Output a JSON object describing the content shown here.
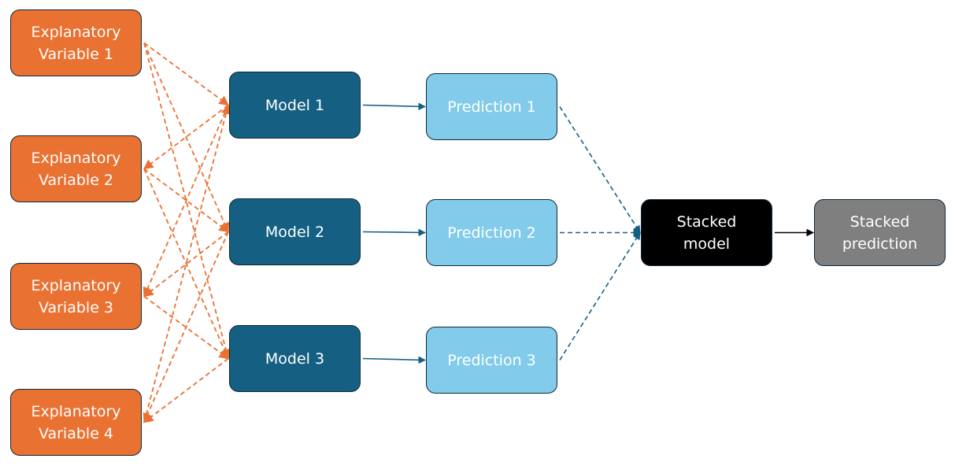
{
  "colors": {
    "explanatory": "#E97132",
    "model": "#156082",
    "prediction": "#83CBEB",
    "stacked_model": "#000000",
    "stacked_prediction": "#7F7F7F",
    "edge_orange": "#E97132",
    "edge_blue": "#156082",
    "edge_black": "#000000"
  },
  "nodes": {
    "ev1": "Explanatory\nVariable 1",
    "ev2": "Explanatory\nVariable 2",
    "ev3": "Explanatory\nVariable 3",
    "ev4": "Explanatory\nVariable 4",
    "m1": "Model 1",
    "m2": "Model 2",
    "m3": "Model 3",
    "p1": "Prediction 1",
    "p2": "Prediction 2",
    "p3": "Prediction 3",
    "sm": "Stacked\nmodel",
    "sp": "Stacked\nprediction"
  },
  "edges": [
    {
      "from": "ev1",
      "to": "m1",
      "style": "dashed",
      "color": "orange"
    },
    {
      "from": "ev1",
      "to": "m2",
      "style": "dashed",
      "color": "orange"
    },
    {
      "from": "ev1",
      "to": "m3",
      "style": "dashed",
      "color": "orange"
    },
    {
      "from": "m1",
      "to": "ev2",
      "style": "dashed",
      "color": "orange"
    },
    {
      "from": "ev2",
      "to": "m2",
      "style": "dashed",
      "color": "orange"
    },
    {
      "from": "ev2",
      "to": "m3",
      "style": "dashed",
      "color": "orange"
    },
    {
      "from": "m1",
      "to": "ev3",
      "style": "dashed",
      "color": "orange"
    },
    {
      "from": "m2",
      "to": "ev3",
      "style": "dashed",
      "color": "orange"
    },
    {
      "from": "ev3",
      "to": "m3",
      "style": "dashed",
      "color": "orange"
    },
    {
      "from": "ev4",
      "to": "m1",
      "style": "dashed",
      "color": "orange"
    },
    {
      "from": "m2",
      "to": "ev4",
      "style": "dashed",
      "color": "orange"
    },
    {
      "from": "m3",
      "to": "ev4",
      "style": "dashed",
      "color": "orange"
    },
    {
      "from": "m1",
      "to": "p1",
      "style": "solid",
      "color": "blue"
    },
    {
      "from": "m2",
      "to": "p2",
      "style": "solid",
      "color": "blue"
    },
    {
      "from": "m3",
      "to": "p3",
      "style": "solid",
      "color": "blue"
    },
    {
      "from": "p1",
      "to": "sm",
      "style": "dashed",
      "color": "blue"
    },
    {
      "from": "p2",
      "to": "sm",
      "style": "dashed",
      "color": "blue"
    },
    {
      "from": "p3",
      "to": "sm",
      "style": "dashed",
      "color": "blue"
    },
    {
      "from": "sm",
      "to": "sp",
      "style": "solid",
      "color": "black"
    }
  ]
}
